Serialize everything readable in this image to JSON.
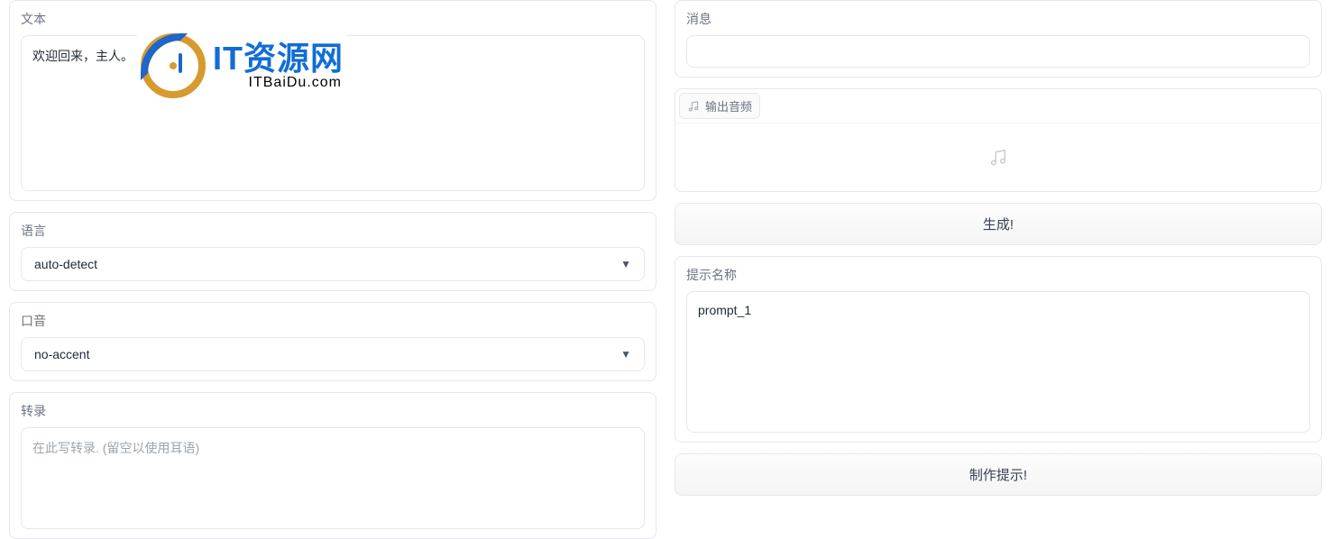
{
  "left": {
    "text_label": "文本",
    "text_value": "欢迎回来，主人。",
    "language_label": "语言",
    "language_value": "auto-detect",
    "accent_label": "口音",
    "accent_value": "no-accent",
    "transcribe_label": "转录",
    "transcribe_placeholder": "在此写转录. (留空以使用耳语)"
  },
  "right": {
    "message_label": "消息",
    "audio_label": "输出音频",
    "generate_btn": "生成!",
    "prompt_name_label": "提示名称",
    "prompt_name_value": "prompt_1",
    "make_prompt_btn": "制作提示!"
  },
  "logo": {
    "title": "IT资源网",
    "subtitle": "ITBaiDu.com"
  }
}
